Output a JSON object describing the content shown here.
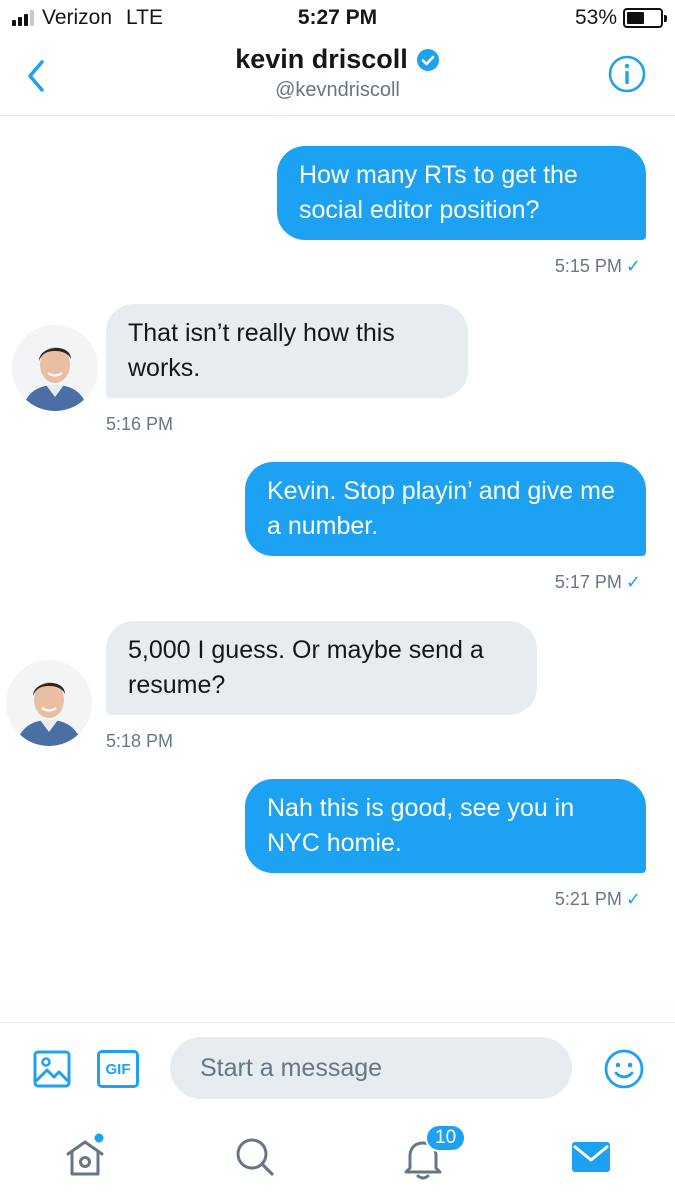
{
  "status_bar": {
    "carrier": "Verizon",
    "network": "LTE",
    "time": "5:27 PM",
    "battery": "53%",
    "battery_level": 0.53,
    "signal_bars": 3
  },
  "header": {
    "name": "kevin driscoll",
    "handle": "@kevndriscoll",
    "verified": true,
    "back_icon": "chevron-left-icon",
    "info_icon": "info-icon"
  },
  "messages": [
    {
      "direction": "outgoing",
      "text": "How many RTs to get the social editor position?",
      "time": "5:15 PM",
      "read": "✓"
    },
    {
      "direction": "incoming",
      "text": "That isn’t really how this works.",
      "time": "5:16 PM"
    },
    {
      "direction": "outgoing",
      "text": "Kevin. Stop playin’ and give me a number.",
      "time": "5:17 PM",
      "read": "✓"
    },
    {
      "direction": "incoming",
      "text": "5,000 I guess. Or maybe send a resume?",
      "time": "5:18 PM"
    },
    {
      "direction": "outgoing",
      "text": "Nah this is good, see you in NYC homie.",
      "time": "5:21 PM",
      "read": "✓"
    }
  ],
  "composer": {
    "placeholder": "Start a message",
    "gif_label": "GIF",
    "photo_icon": "image-icon",
    "emoji_icon": "emoji-icon"
  },
  "tabbar": {
    "items": [
      {
        "name": "home",
        "icon": "home-icon",
        "has_dot": true
      },
      {
        "name": "search",
        "icon": "search-icon"
      },
      {
        "name": "notifications",
        "icon": "bell-icon",
        "badge": "10"
      },
      {
        "name": "messages",
        "icon": "mail-icon",
        "active": true
      }
    ]
  },
  "colors": {
    "accent": "#1da1f2",
    "incoming_bubble": "#e6ecf0",
    "secondary_text": "#657786"
  }
}
